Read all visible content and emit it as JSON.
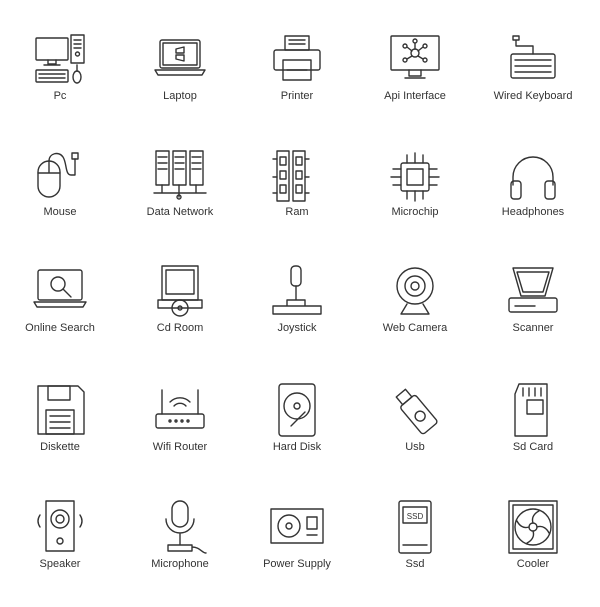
{
  "colors": {
    "stroke": "#333333",
    "background": "#ffffff"
  },
  "icons": [
    {
      "label": "Pc",
      "icon": "pc-icon"
    },
    {
      "label": "Laptop",
      "icon": "laptop-icon"
    },
    {
      "label": "Printer",
      "icon": "printer-icon"
    },
    {
      "label": "Api Interface",
      "icon": "api-interface-icon"
    },
    {
      "label": "Wired Keyboard",
      "icon": "wired-keyboard-icon"
    },
    {
      "label": "Mouse",
      "icon": "mouse-icon"
    },
    {
      "label": "Data Network",
      "icon": "data-network-icon"
    },
    {
      "label": "Ram",
      "icon": "ram-icon"
    },
    {
      "label": "Microchip",
      "icon": "microchip-icon"
    },
    {
      "label": "Headphones",
      "icon": "headphones-icon"
    },
    {
      "label": "Online Search",
      "icon": "online-search-icon"
    },
    {
      "label": "Cd Room",
      "icon": "cd-room-icon"
    },
    {
      "label": "Joystick",
      "icon": "joystick-icon"
    },
    {
      "label": "Web Camera",
      "icon": "web-camera-icon"
    },
    {
      "label": "Scanner",
      "icon": "scanner-icon"
    },
    {
      "label": "Diskette",
      "icon": "diskette-icon"
    },
    {
      "label": "Wifi Router",
      "icon": "wifi-router-icon"
    },
    {
      "label": "Hard Disk",
      "icon": "hard-disk-icon"
    },
    {
      "label": "Usb",
      "icon": "usb-icon"
    },
    {
      "label": "Sd Card",
      "icon": "sd-card-icon"
    },
    {
      "label": "Speaker",
      "icon": "speaker-icon"
    },
    {
      "label": "Microphone",
      "icon": "microphone-icon"
    },
    {
      "label": "Power Supply",
      "icon": "power-supply-icon"
    },
    {
      "label": "Ssd",
      "icon": "ssd-icon",
      "text": "SSD"
    },
    {
      "label": "Cooler",
      "icon": "cooler-icon"
    }
  ]
}
